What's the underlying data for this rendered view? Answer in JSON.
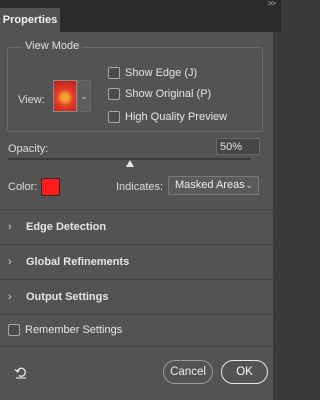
{
  "panel": {
    "tab_label": "Properties",
    "collapse_glyph": ">>"
  },
  "view_mode": {
    "group_label": "View Mode",
    "view_label": "View:",
    "options": [
      {
        "label": "Show Edge (J)",
        "checked": false
      },
      {
        "label": "Show Original (P)",
        "checked": false
      },
      {
        "label": "High Quality Preview",
        "checked": false
      }
    ]
  },
  "opacity": {
    "label": "Opacity:",
    "value": "50%",
    "slider_fraction": 0.5
  },
  "color": {
    "label": "Color:",
    "swatch": "#ff1a1a"
  },
  "indicates": {
    "label": "Indicates:",
    "selected": "Masked Areas"
  },
  "sections": [
    {
      "chevron": "›",
      "title": "Edge Detection"
    },
    {
      "chevron": "›",
      "title": "Global Refinements"
    },
    {
      "chevron": "›",
      "title": "Output Settings"
    }
  ],
  "remember": {
    "label": "Remember Settings",
    "checked": false
  },
  "buttons": {
    "cancel": "Cancel",
    "ok": "OK"
  },
  "icons": {
    "reset": "reset-icon",
    "thumbnail_dropdown": "chevron-down-icon",
    "select_arrow": "chevron-down-icon"
  }
}
